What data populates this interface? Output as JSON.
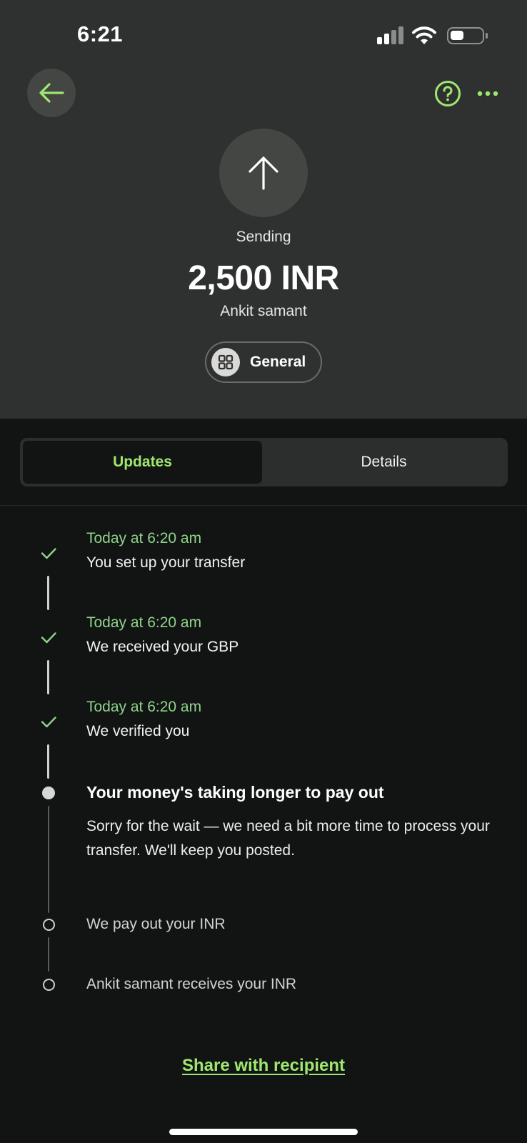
{
  "status_bar": {
    "time": "6:21"
  },
  "header": {
    "status_label": "Sending",
    "amount": "2,500 INR",
    "recipient": "Ankit samant",
    "category": "General"
  },
  "tabs": [
    {
      "label": "Updates",
      "active": true
    },
    {
      "label": "Details",
      "active": false
    }
  ],
  "timeline": {
    "completed": [
      {
        "time": "Today at 6:20 am",
        "text": "You set up your transfer"
      },
      {
        "time": "Today at 6:20 am",
        "text": "We received your GBP"
      },
      {
        "time": "Today at 6:20 am",
        "text": "We verified you"
      }
    ],
    "current": {
      "title": "Your money's taking longer to pay out",
      "body": "Sorry for the wait — we need a bit more time to process your transfer. We'll keep you posted."
    },
    "pending": [
      {
        "text": "We pay out your INR"
      },
      {
        "text": "Ankit samant receives your INR"
      }
    ]
  },
  "share_link": "Share with recipient",
  "icons": {
    "back": "arrow-left-icon",
    "help": "question-circle-icon",
    "more": "more-dots-icon",
    "hero": "arrow-up-icon",
    "category": "grid-icon"
  },
  "colors": {
    "accent": "#9fe870",
    "timestamp": "#8fd48a",
    "header_bg": "#2f3130",
    "body_bg": "#121413"
  }
}
